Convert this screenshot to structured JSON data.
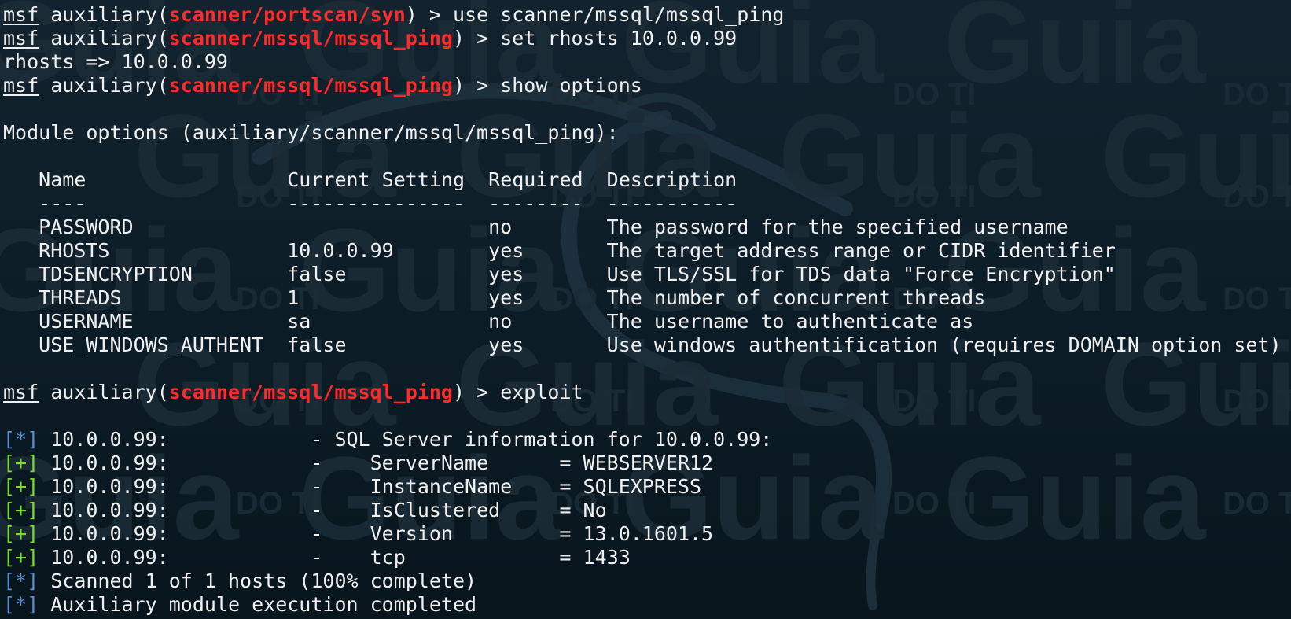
{
  "terminal": {
    "prompt": "msf",
    "module_type": "auxiliary",
    "watermark_primary": "Guia",
    "watermark_secondary": "DO TI",
    "colors": {
      "background": "#0c1c26",
      "foreground": "#f0f0f0",
      "module_red": "#ff2b2b",
      "status_info": "#5b8fd0",
      "status_good": "#7ddc2a"
    },
    "commands": [
      {
        "module": "scanner/portscan/syn",
        "command": "use scanner/mssql/mssql_ping"
      },
      {
        "module": "scanner/mssql/mssql_ping",
        "command": "set rhosts 10.0.0.99"
      },
      {
        "module": "scanner/mssql/mssql_ping",
        "command": "show options"
      },
      {
        "module": "scanner/mssql/mssql_ping",
        "command": "exploit"
      }
    ],
    "set_output": "rhosts => 10.0.0.99",
    "module_options": {
      "title": "Module options (auxiliary/scanner/mssql/mssql_ping):",
      "headers": [
        "Name",
        "Current Setting",
        "Required",
        "Description"
      ],
      "rows": [
        [
          "PASSWORD",
          "",
          "no",
          "The password for the specified username"
        ],
        [
          "RHOSTS",
          "10.0.0.99",
          "yes",
          "The target address range or CIDR identifier"
        ],
        [
          "TDSENCRYPTION",
          "false",
          "yes",
          "Use TLS/SSL for TDS data \"Force Encryption\""
        ],
        [
          "THREADS",
          "1",
          "yes",
          "The number of concurrent threads"
        ],
        [
          "USERNAME",
          "sa",
          "no",
          "The username to authenticate as"
        ],
        [
          "USE_WINDOWS_AUTHENT",
          "false",
          "yes",
          "Use windows authentification (requires DOMAIN option set)"
        ]
      ]
    },
    "results": [
      {
        "status": "info",
        "marker": "[*]",
        "host": "10.0.0.99:",
        "label": "SQL Server information for 10.0.0.99:",
        "value": ""
      },
      {
        "status": "good",
        "marker": "[+]",
        "host": "10.0.0.99:",
        "label": "ServerName",
        "value": "WEBSERVER12"
      },
      {
        "status": "good",
        "marker": "[+]",
        "host": "10.0.0.99:",
        "label": "InstanceName",
        "value": "SQLEXPRESS"
      },
      {
        "status": "good",
        "marker": "[+]",
        "host": "10.0.0.99:",
        "label": "IsClustered",
        "value": "No"
      },
      {
        "status": "good",
        "marker": "[+]",
        "host": "10.0.0.99:",
        "label": "Version",
        "value": "13.0.1601.5"
      },
      {
        "status": "good",
        "marker": "[+]",
        "host": "10.0.0.99:",
        "label": "tcp",
        "value": "1433"
      }
    ],
    "summary": [
      {
        "status": "info",
        "marker": "[*]",
        "text": "Scanned 1 of 1 hosts (100% complete)"
      },
      {
        "status": "info",
        "marker": "[*]",
        "text": "Auxiliary module execution completed"
      }
    ]
  }
}
